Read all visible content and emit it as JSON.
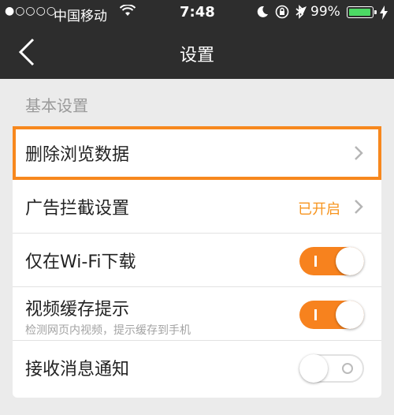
{
  "status_bar": {
    "signal": "●○○○○",
    "carrier": "中国移动",
    "time": "7:48",
    "battery_percent": "99%",
    "battery_level": 0.99,
    "battery_color": "#4cd964"
  },
  "nav": {
    "title": "设置",
    "back_icon": "chevron-left-icon"
  },
  "section": {
    "label": "基本设置"
  },
  "rows": [
    {
      "label": "删除浏览数据",
      "type": "link"
    },
    {
      "label": "广告拦截设置",
      "type": "link",
      "status": "已开启"
    },
    {
      "label": "仅在Wi-Fi下载",
      "type": "toggle",
      "on": true
    },
    {
      "label": "视频缓存提示",
      "sub": "检测网页内视频，提示缓存到手机",
      "type": "toggle",
      "on": true
    },
    {
      "label": "接收消息通知",
      "type": "toggle",
      "on": false
    }
  ],
  "colors": {
    "accent": "#f7821e",
    "highlight_border": "#f7881e",
    "header_bg": "#2d2d2d",
    "page_bg": "#ebebeb"
  }
}
